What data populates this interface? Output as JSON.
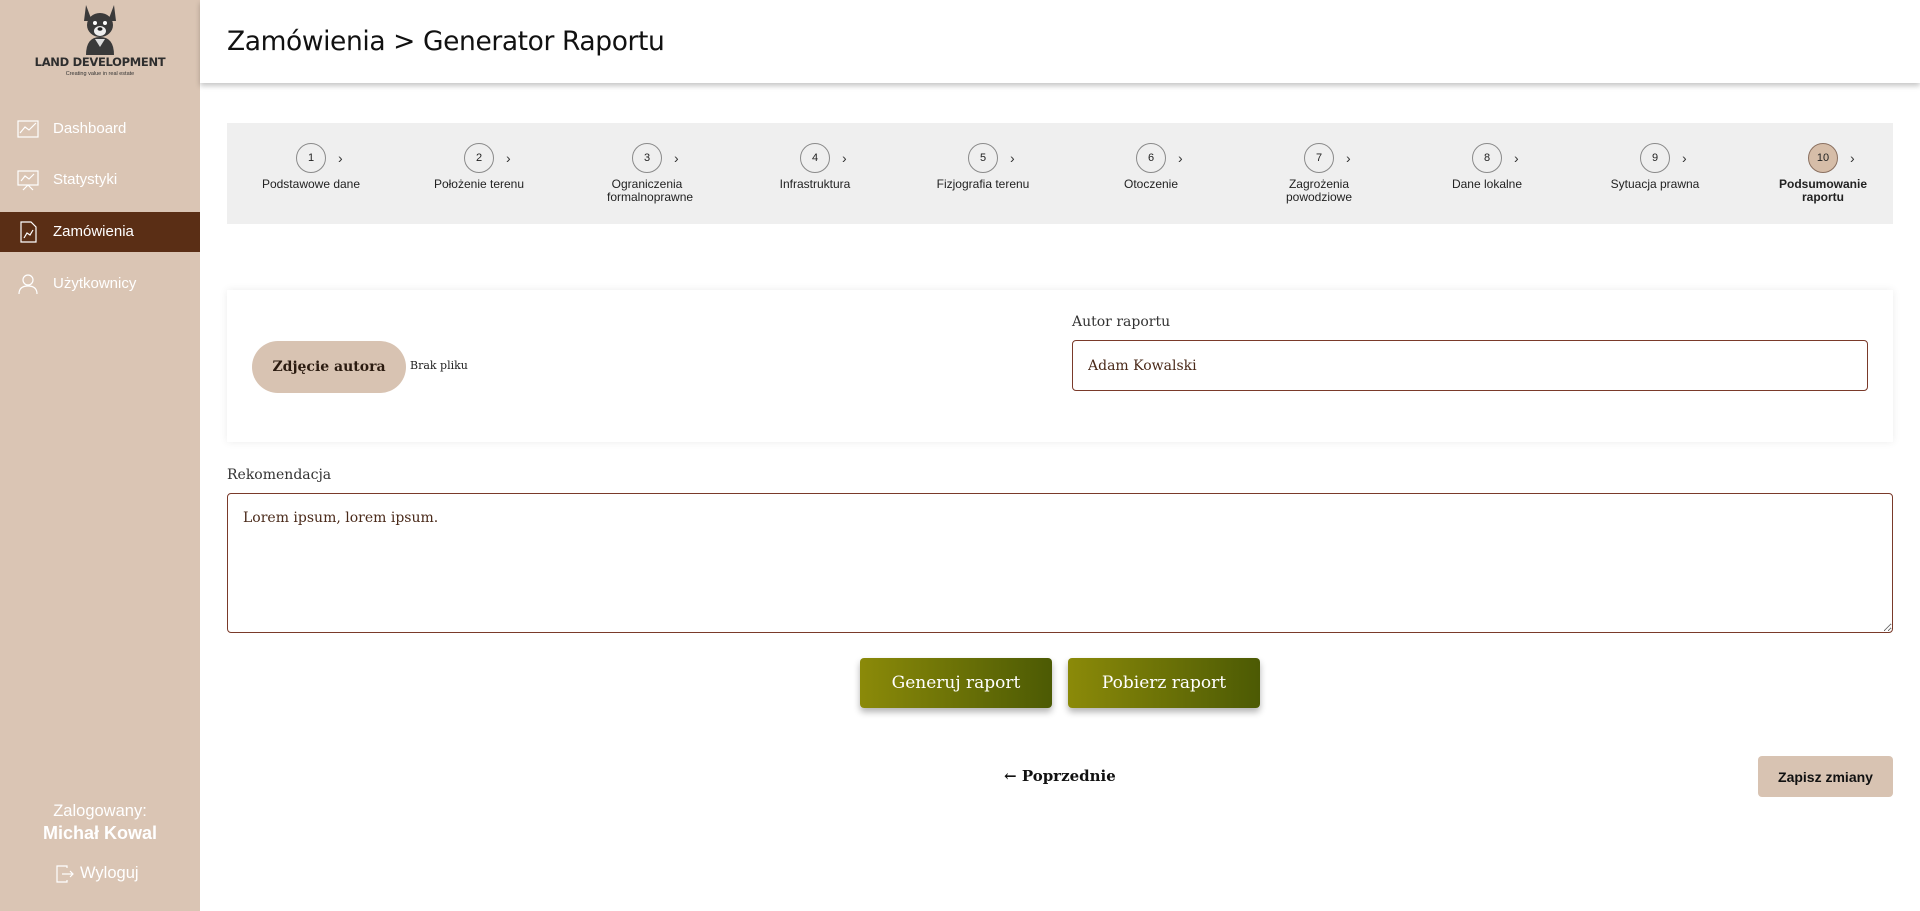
{
  "brand": {
    "name": "LAND DEVELOPMENT",
    "tagline": "Creating value in real estate"
  },
  "sidebar": {
    "items": [
      {
        "label": "Dashboard",
        "icon": "chart-line-icon",
        "active": false
      },
      {
        "label": "Statystyki",
        "icon": "presentation-board-icon",
        "active": false
      },
      {
        "label": "Zamówienia",
        "icon": "document-chart-icon",
        "active": true
      },
      {
        "label": "Użytkownicy",
        "icon": "user-icon",
        "active": false
      }
    ],
    "logged_label": "Zalogowany:",
    "logged_user": "Michał Kowal",
    "logout_label": "Wyloguj"
  },
  "header": {
    "title": "Zamówienia > Generator Raportu"
  },
  "stepper": {
    "steps": [
      {
        "num": "1",
        "label": "Podstawowe dane"
      },
      {
        "num": "2",
        "label": "Położenie terenu"
      },
      {
        "num": "3",
        "label": "Ograniczenia formalnoprawne"
      },
      {
        "num": "4",
        "label": "Infrastruktura"
      },
      {
        "num": "5",
        "label": "Fizjografia terenu"
      },
      {
        "num": "6",
        "label": "Otoczenie"
      },
      {
        "num": "7",
        "label": "Zagrożenia powodziowe"
      },
      {
        "num": "8",
        "label": "Dane lokalne"
      },
      {
        "num": "9",
        "label": "Sytuacja prawna"
      },
      {
        "num": "10",
        "label": "Podsumowanie raportu"
      }
    ],
    "current": 10
  },
  "author_card": {
    "photo_button": "Zdjęcie autora",
    "no_file": "Brak pliku",
    "author_label": "Autor raportu",
    "author_value": "Adam Kowalski"
  },
  "recommendation": {
    "label": "Rekomendacja",
    "value": "Lorem ipsum, lorem ipsum."
  },
  "actions": {
    "generate": "Generuj raport",
    "download": "Pobierz raport",
    "previous": "Poprzednie",
    "save": "Zapisz zmiany"
  },
  "colors": {
    "sidebar": "#dac5b4",
    "active_nav": "#5a2e15",
    "olive_start": "#8b8a09",
    "olive_end": "#4c5a04"
  }
}
